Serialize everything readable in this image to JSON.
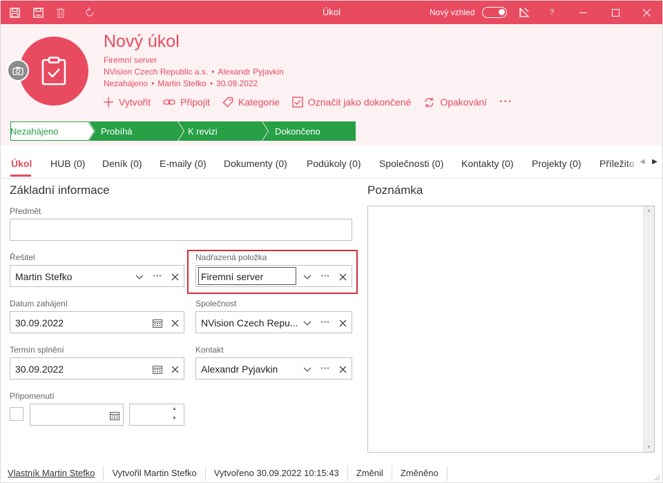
{
  "titlebar": {
    "title": "Úkol",
    "new_look_label": "Nový vzhled",
    "help_label": "?",
    "icons": [
      "save-icon",
      "save-close-icon",
      "delete-icon",
      "refresh-icon",
      "ruler-icon"
    ]
  },
  "header": {
    "title": "Nový úkol",
    "parent": "Firemní server",
    "company": "NVision Czech Republic a.s.",
    "contact": "Alexandr Pyjavkin",
    "status": "Nezahájeno",
    "solver": "Martin Stefko",
    "date": "30.09.2022",
    "separator": "•"
  },
  "actions": {
    "create": "Vytvořit",
    "attach": "Připojit",
    "category": "Kategorie",
    "mark_done": "Označit jako dokončené",
    "repeat": "Opakování",
    "more": "···"
  },
  "flow": [
    "Nezahájeno",
    "Probíhá",
    "K revizi",
    "Dokončeno"
  ],
  "tabs": [
    "Úkol",
    "HUB (0)",
    "Deník (0)",
    "E-maily (0)",
    "Dokumenty (0)",
    "Podúkoly (0)",
    "Společnosti (0)",
    "Kontakty (0)",
    "Projekty (0)",
    "Příležito"
  ],
  "form": {
    "section_title": "Základní informace",
    "subject_label": "Předmět",
    "subject_value": "",
    "solver_label": "Řešitel",
    "solver_value": "Martin Stefko",
    "parent_label": "Nadřazená položka",
    "parent_value": "Firemní server",
    "start_label": "Datum zahájení",
    "start_value": "30.09.2022",
    "company_label": "Společnost",
    "company_value": "NVision Czech Repu...",
    "due_label": "Termín splnění",
    "due_value": "30.09.2022",
    "contact_label": "Kontakt",
    "contact_value": "Alexandr Pyjavkin",
    "reminder_label": "Připomenutí",
    "more": "···"
  },
  "note": {
    "title": "Poznámka"
  },
  "footer": {
    "owner": "Vlastník Martin Stefko",
    "created_by": "Vytvořil Martin Stefko",
    "created_at": "Vytvořeno 30.09.2022 10:15:43",
    "changed_by": "Změnil",
    "changed_at": "Změněno"
  },
  "colors": {
    "accent": "#e84a5f",
    "stage_done": "#27a046",
    "highlight": "#d62b38"
  }
}
